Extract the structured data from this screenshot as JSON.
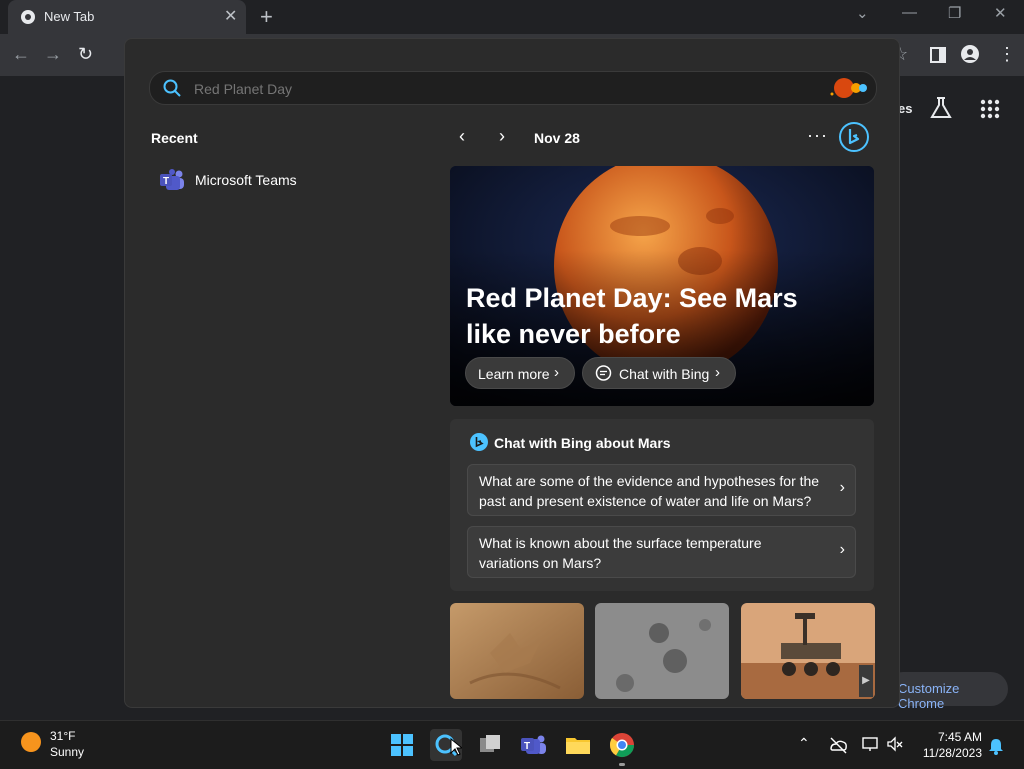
{
  "browser": {
    "tab_title": "New Tab",
    "new_tab_symbol": "+",
    "customize_label": "Customize Chrome",
    "visible_partial_text": "es"
  },
  "flyout": {
    "search": {
      "value": "",
      "placeholder": "Red Planet Day"
    },
    "recent": {
      "label": "Recent",
      "items": [
        {
          "label": "Microsoft Teams",
          "icon": "teams-icon"
        }
      ]
    },
    "date_label": "Nov 28",
    "hero": {
      "title": "Red Planet Day: See Mars like never before",
      "learn_more": "Learn more",
      "chat_bing": "Chat with Bing"
    },
    "chat_card": {
      "heading": "Chat with Bing about Mars",
      "questions": [
        "What are some of the evidence and hypotheses for the past and present existence of water and life on Mars?",
        "What is known about the surface temperature variations on Mars?"
      ]
    }
  },
  "taskbar": {
    "weather": {
      "temp": "31°F",
      "condition": "Sunny"
    },
    "time": "7:45 AM",
    "date": "11/28/2023"
  },
  "colors": {
    "accent": "#4cc2ff",
    "flyout_bg": "#2b2b2b",
    "taskbar_bg": "#1c1c1c"
  }
}
